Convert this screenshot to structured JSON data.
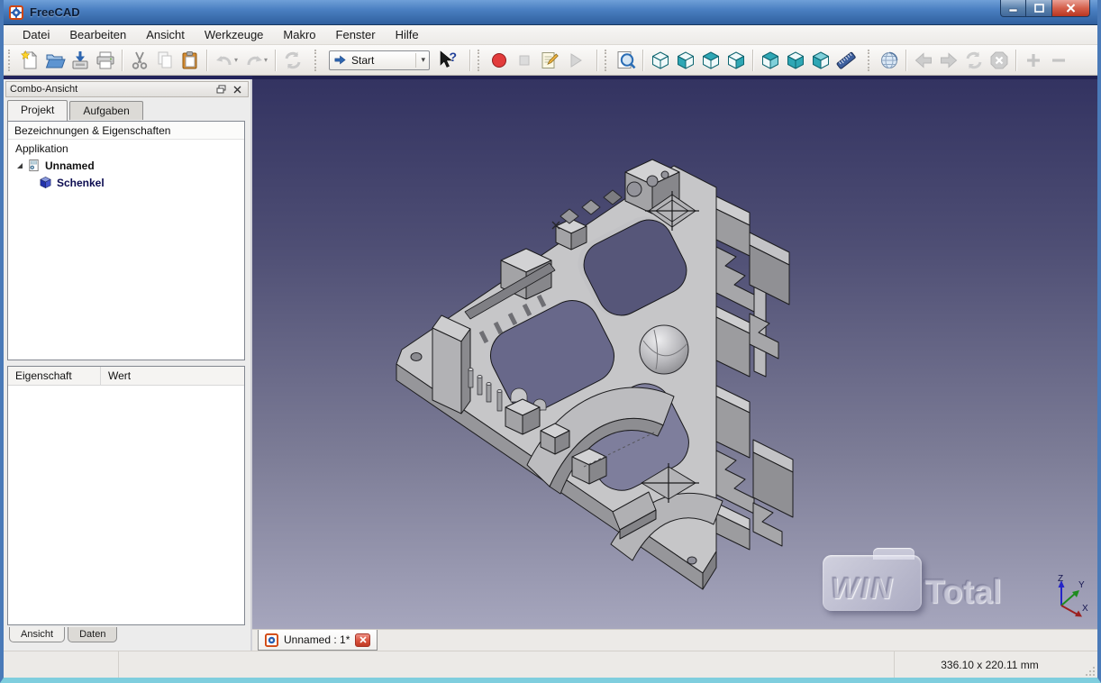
{
  "window": {
    "title": "FreeCAD",
    "controls": {
      "minimize": "minimize",
      "maximize": "maximize",
      "close": "close"
    }
  },
  "menu_bar": {
    "items": [
      "Datei",
      "Bearbeiten",
      "Ansicht",
      "Werkzeuge",
      "Makro",
      "Fenster",
      "Hilfe"
    ]
  },
  "toolbars": {
    "file": {
      "buttons": [
        "new-document",
        "open-document",
        "save-document",
        "print"
      ]
    },
    "edit": {
      "buttons": [
        "cut",
        "copy",
        "paste",
        "undo",
        "redo",
        "refresh"
      ]
    },
    "workbench": {
      "selected": "Start",
      "caret": "▾",
      "whats_this": "whats-this"
    },
    "macro": {
      "buttons": [
        "record-macro",
        "stop-macro",
        "edit-macro",
        "play-macro"
      ]
    },
    "view": {
      "buttons": [
        "fit-all",
        "view-axonometric",
        "view-front",
        "view-top",
        "view-right",
        "view-rear",
        "view-bottom",
        "view-left",
        "measure-distance"
      ]
    },
    "web": {
      "buttons": [
        "open-website",
        "back",
        "forward",
        "web-refresh",
        "web-stop",
        "zoom-in",
        "zoom-out"
      ]
    }
  },
  "combo_view": {
    "title": "Combo-Ansicht",
    "tabs": [
      {
        "label": "Projekt",
        "active": true
      },
      {
        "label": "Aufgaben",
        "active": false
      }
    ],
    "tree": {
      "header": "Bezeichnungen & Eigenschaften",
      "root": "Applikation",
      "items": [
        {
          "label": "Unnamed",
          "icon": "document-icon",
          "expanded": true
        },
        {
          "label": "Schenkel",
          "icon": "part-cube-icon"
        }
      ]
    },
    "properties": {
      "columns": [
        "Eigenschaft",
        "Wert"
      ],
      "rows": []
    },
    "bottom_tabs": [
      {
        "label": "Ansicht",
        "active": true
      },
      {
        "label": "Daten",
        "active": false
      }
    ]
  },
  "viewport": {
    "document_tab": {
      "label": "Unnamed : 1*",
      "icon": "freecad-icon"
    },
    "watermark": {
      "line1": "WIN",
      "line2": "Total"
    },
    "axes": {
      "x": "X",
      "y": "Y",
      "z": "Z"
    },
    "background": {
      "top": "#333361",
      "bottom": "#a6a6bd"
    },
    "model": {
      "name": "Schenkel",
      "color": "#c7c7c9"
    }
  },
  "status_bar": {
    "dimensions": "336.10 x 220.11 mm"
  }
}
